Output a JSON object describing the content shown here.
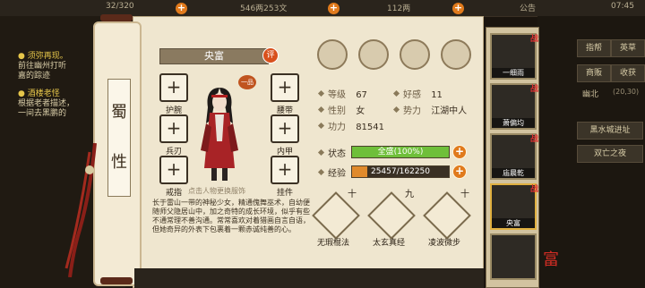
{
  "topbar": {
    "stamina": "32/320",
    "money": "546两253文",
    "silver": "112两",
    "announce": "公告",
    "clock": "07:45"
  },
  "quests": [
    {
      "title": "● 须弥再现。",
      "lines": [
        "前往幽州打听",
        "嘉的踪迹"
      ]
    },
    {
      "title": "● 酒楼老怪",
      "lines": [
        "根据老者描述，",
        "一间去黑鹏的"
      ]
    }
  ],
  "right_panel": {
    "buttons": [
      "指帮",
      "英草",
      "商贩",
      "收获"
    ],
    "location": "幽北",
    "coords": "(20,30)",
    "tasks": [
      "黑水城进址",
      "双亡之夜"
    ]
  },
  "character": {
    "section": [
      "蜀",
      "性"
    ],
    "name": "央富",
    "eval": "评",
    "rank_badge": "一品",
    "slots": {
      "protect": "护腕",
      "belt": "腰带",
      "weapon": "兵刃",
      "armor": "内甲",
      "ring": "戒指",
      "pendant": "挂件"
    },
    "portrait_tip": "点击人物更换服饰"
  },
  "round_icons": [
    "sword-icon",
    "scroll-icon",
    "yinyang-icon",
    "meridian-icon"
  ],
  "stats": {
    "level_label": "等级",
    "level": "67",
    "favor_label": "好感",
    "favor": "11",
    "gender_label": "性别",
    "gender": "女",
    "faction_label": "势力",
    "faction": "江湖中人",
    "power_label": "功力",
    "power": "81541",
    "status_label": "状态",
    "status_text": "全盛(100%)",
    "status_fraction": 1.0,
    "exp_label": "经验",
    "exp_text": "25457/162250",
    "exp_fraction": 0.157
  },
  "description": "长于雷山一带的神秘少女，精通傀舞巫术，自幼便随师父隐居山中，加之奇特的成长环境，似乎有些不通常理不善沟通。常常喜欢对着猎画自言自语，但她奇异的外表下包裹着一颗赤诚纯善的心。",
  "skills": [
    {
      "name": "无瑕棍法",
      "rank": "十"
    },
    {
      "name": "太玄真经",
      "rank": "九"
    },
    {
      "name": "凌波微步",
      "rank": "十"
    }
  ],
  "party": [
    {
      "name": "一细雨",
      "badge": "战"
    },
    {
      "name": "萧偏均",
      "badge": "战"
    },
    {
      "name": "庙晨乾",
      "badge": "战"
    },
    {
      "name": "央富",
      "badge": "战"
    },
    {
      "name": "",
      "badge": ""
    }
  ],
  "corner_stamp": "富"
}
